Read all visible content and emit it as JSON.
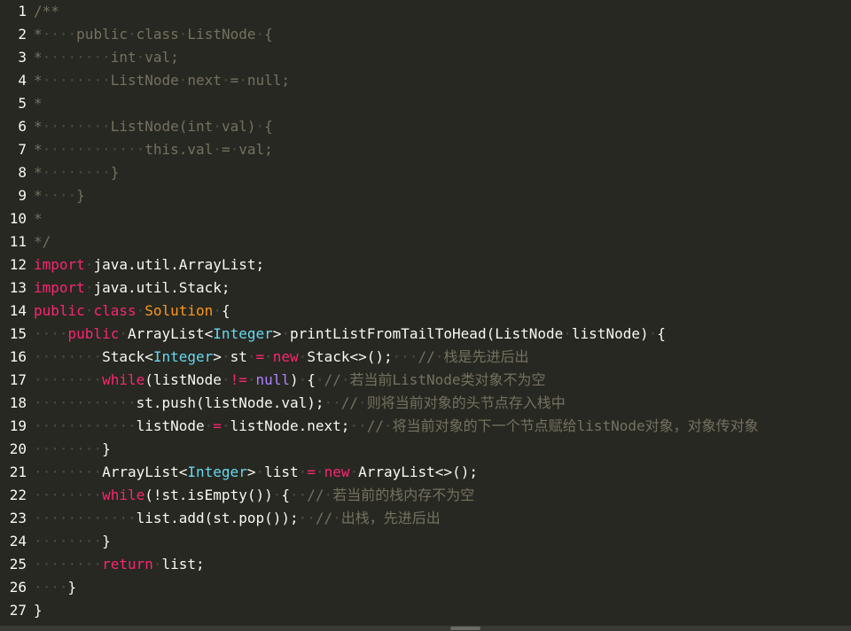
{
  "editor": {
    "theme": {
      "background": "#272822",
      "comment": "#75715e",
      "keyword": "#f92672",
      "type": "#66d9ef",
      "class_name": "#fd971f",
      "literal": "#ae81ff",
      "text": "#f8f8f2",
      "whitespace_marker": "#4b4b42"
    },
    "lines": [
      {
        "n": "1",
        "tokens": [
          [
            "cm",
            "/**"
          ]
        ]
      },
      {
        "n": "2",
        "tokens": [
          [
            "cm",
            "*"
          ],
          [
            "ws",
            "····"
          ],
          [
            "cm",
            "public"
          ],
          [
            "ws",
            "·"
          ],
          [
            "cm",
            "class"
          ],
          [
            "ws",
            "·"
          ],
          [
            "cm",
            "ListNode"
          ],
          [
            "ws",
            "·"
          ],
          [
            "cm",
            "{"
          ]
        ]
      },
      {
        "n": "3",
        "tokens": [
          [
            "cm",
            "*"
          ],
          [
            "ws",
            "········"
          ],
          [
            "cm",
            "int"
          ],
          [
            "ws",
            "·"
          ],
          [
            "cm",
            "val;"
          ]
        ]
      },
      {
        "n": "4",
        "tokens": [
          [
            "cm",
            "*"
          ],
          [
            "ws",
            "········"
          ],
          [
            "cm",
            "ListNode"
          ],
          [
            "ws",
            "·"
          ],
          [
            "cm",
            "next"
          ],
          [
            "ws",
            "·"
          ],
          [
            "cm",
            "="
          ],
          [
            "ws",
            "·"
          ],
          [
            "cm",
            "null;"
          ]
        ]
      },
      {
        "n": "5",
        "tokens": [
          [
            "cm",
            "*"
          ]
        ]
      },
      {
        "n": "6",
        "tokens": [
          [
            "cm",
            "*"
          ],
          [
            "ws",
            "········"
          ],
          [
            "cm",
            "ListNode(int"
          ],
          [
            "ws",
            "·"
          ],
          [
            "cm",
            "val)"
          ],
          [
            "ws",
            "·"
          ],
          [
            "cm",
            "{"
          ]
        ]
      },
      {
        "n": "7",
        "tokens": [
          [
            "cm",
            "*"
          ],
          [
            "ws",
            "············"
          ],
          [
            "cm",
            "this.val"
          ],
          [
            "ws",
            "·"
          ],
          [
            "cm",
            "="
          ],
          [
            "ws",
            "·"
          ],
          [
            "cm",
            "val;"
          ]
        ]
      },
      {
        "n": "8",
        "tokens": [
          [
            "cm",
            "*"
          ],
          [
            "ws",
            "········"
          ],
          [
            "cm",
            "}"
          ]
        ]
      },
      {
        "n": "9",
        "tokens": [
          [
            "cm",
            "*"
          ],
          [
            "ws",
            "····"
          ],
          [
            "cm",
            "}"
          ]
        ]
      },
      {
        "n": "10",
        "tokens": [
          [
            "cm",
            "*"
          ]
        ]
      },
      {
        "n": "11",
        "tokens": [
          [
            "cm",
            "*/"
          ]
        ]
      },
      {
        "n": "12",
        "tokens": [
          [
            "kw",
            "import"
          ],
          [
            "ws",
            "·"
          ],
          [
            "tx",
            "java.util.ArrayList;"
          ]
        ]
      },
      {
        "n": "13",
        "tokens": [
          [
            "kw",
            "import"
          ],
          [
            "ws",
            "·"
          ],
          [
            "tx",
            "java.util.Stack;"
          ]
        ]
      },
      {
        "n": "14",
        "tokens": [
          [
            "kw",
            "public"
          ],
          [
            "ws",
            "·"
          ],
          [
            "kw",
            "class"
          ],
          [
            "ws",
            "·"
          ],
          [
            "cl",
            "Solution"
          ],
          [
            "ws",
            "·"
          ],
          [
            "tx",
            "{"
          ]
        ]
      },
      {
        "n": "15",
        "tokens": [
          [
            "ws",
            "····"
          ],
          [
            "kw",
            "public"
          ],
          [
            "ws",
            "·"
          ],
          [
            "tx",
            "ArrayList<"
          ],
          [
            "ty",
            "Integer"
          ],
          [
            "tx",
            ">"
          ],
          [
            "ws",
            "·"
          ],
          [
            "tx",
            "printListFromTailToHead(ListNode"
          ],
          [
            "ws",
            "·"
          ],
          [
            "tx",
            "listNode)"
          ],
          [
            "ws",
            "·"
          ],
          [
            "tx",
            "{"
          ]
        ]
      },
      {
        "n": "16",
        "tokens": [
          [
            "ws",
            "········"
          ],
          [
            "tx",
            "Stack<"
          ],
          [
            "ty",
            "Integer"
          ],
          [
            "tx",
            ">"
          ],
          [
            "ws",
            "·"
          ],
          [
            "tx",
            "st"
          ],
          [
            "ws",
            "·"
          ],
          [
            "op",
            "="
          ],
          [
            "ws",
            "·"
          ],
          [
            "kw",
            "new"
          ],
          [
            "ws",
            "·"
          ],
          [
            "tx",
            "Stack<>();"
          ],
          [
            "ws",
            "···"
          ],
          [
            "cm",
            "//"
          ],
          [
            "ws",
            "·"
          ],
          [
            "cm",
            "栈是先进后出"
          ]
        ]
      },
      {
        "n": "17",
        "tokens": [
          [
            "ws",
            "········"
          ],
          [
            "kw",
            "while"
          ],
          [
            "tx",
            "(listNode"
          ],
          [
            "ws",
            "·"
          ],
          [
            "op",
            "!="
          ],
          [
            "ws",
            "·"
          ],
          [
            "lit",
            "null"
          ],
          [
            "tx",
            ")"
          ],
          [
            "ws",
            "·"
          ],
          [
            "tx",
            "{"
          ],
          [
            "ws",
            "·"
          ],
          [
            "cm",
            "//"
          ],
          [
            "ws",
            "·"
          ],
          [
            "cm",
            "若当前ListNode类对象不为空"
          ]
        ]
      },
      {
        "n": "18",
        "tokens": [
          [
            "ws",
            "············"
          ],
          [
            "tx",
            "st.push(listNode.val);"
          ],
          [
            "ws",
            "··"
          ],
          [
            "cm",
            "//"
          ],
          [
            "ws",
            "·"
          ],
          [
            "cm",
            "则将当前对象的头节点存入栈中"
          ]
        ]
      },
      {
        "n": "19",
        "tokens": [
          [
            "ws",
            "············"
          ],
          [
            "tx",
            "listNode"
          ],
          [
            "ws",
            "·"
          ],
          [
            "op",
            "="
          ],
          [
            "ws",
            "·"
          ],
          [
            "tx",
            "listNode.next;"
          ],
          [
            "ws",
            "··"
          ],
          [
            "cm",
            "//"
          ],
          [
            "ws",
            "·"
          ],
          [
            "cm",
            "将当前对象的下一个节点赋给listNode对象，对象传对象"
          ]
        ]
      },
      {
        "n": "20",
        "tokens": [
          [
            "ws",
            "········"
          ],
          [
            "tx",
            "}"
          ]
        ]
      },
      {
        "n": "21",
        "tokens": [
          [
            "ws",
            "········"
          ],
          [
            "tx",
            "ArrayList<"
          ],
          [
            "ty",
            "Integer"
          ],
          [
            "tx",
            ">"
          ],
          [
            "ws",
            "·"
          ],
          [
            "tx",
            "list"
          ],
          [
            "ws",
            "·"
          ],
          [
            "op",
            "="
          ],
          [
            "ws",
            "·"
          ],
          [
            "kw",
            "new"
          ],
          [
            "ws",
            "·"
          ],
          [
            "tx",
            "ArrayList<>();"
          ]
        ]
      },
      {
        "n": "22",
        "tokens": [
          [
            "ws",
            "········"
          ],
          [
            "kw",
            "while"
          ],
          [
            "tx",
            "(!st.isEmpty())"
          ],
          [
            "ws",
            "·"
          ],
          [
            "tx",
            "{"
          ],
          [
            "ws",
            "··"
          ],
          [
            "cm",
            "//"
          ],
          [
            "ws",
            "·"
          ],
          [
            "cm",
            "若当前的栈内存不为空"
          ]
        ]
      },
      {
        "n": "23",
        "tokens": [
          [
            "ws",
            "············"
          ],
          [
            "tx",
            "list.add(st.pop());"
          ],
          [
            "ws",
            "··"
          ],
          [
            "cm",
            "//"
          ],
          [
            "ws",
            "·"
          ],
          [
            "cm",
            "出栈，先进后出"
          ]
        ]
      },
      {
        "n": "24",
        "tokens": [
          [
            "ws",
            "········"
          ],
          [
            "tx",
            "}"
          ]
        ]
      },
      {
        "n": "25",
        "tokens": [
          [
            "ws",
            "········"
          ],
          [
            "kw",
            "return"
          ],
          [
            "ws",
            "·"
          ],
          [
            "tx",
            "list;"
          ]
        ]
      },
      {
        "n": "26",
        "tokens": [
          [
            "ws",
            "····"
          ],
          [
            "tx",
            "}"
          ]
        ]
      },
      {
        "n": "27",
        "tokens": [
          [
            "tx",
            "}"
          ]
        ]
      }
    ]
  }
}
